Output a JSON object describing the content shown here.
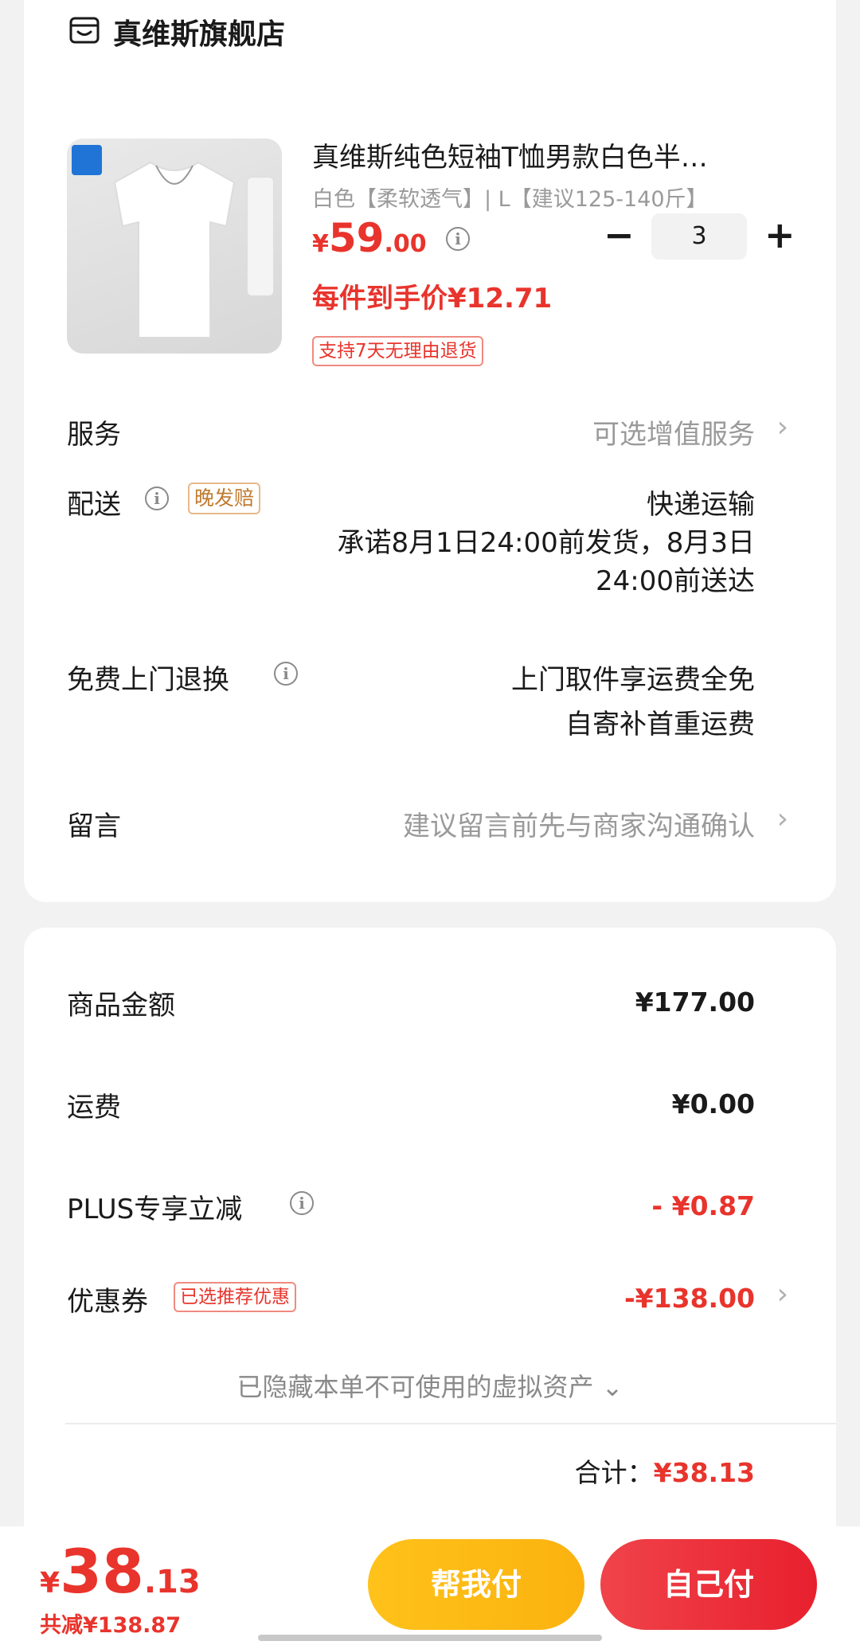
{
  "store": {
    "name": "真维斯旗舰店",
    "icon": "store-icon"
  },
  "product": {
    "title": "真维斯纯色短袖T恤男款白色半…",
    "variant": "白色【柔软透气】| L【建议125-140斤】",
    "price_symbol": "¥",
    "price_int": "59",
    "price_dec": ".00",
    "quantity": "3",
    "minus_label": "−",
    "plus_label": "+",
    "unit_price_label": "每件到手价¥12.71",
    "return_badge": "支持7天无理由退货"
  },
  "rows": {
    "service_label": "服务",
    "service_value": "可选增值服务",
    "delivery_label": "配送",
    "delivery_badge": "晚发赔",
    "delivery_method": "快递运输",
    "delivery_promise_line1": "承诺8月1日24:00前发货，8月3日",
    "delivery_promise_line2": "24:00前送达",
    "return_label": "免费上门退换",
    "return_line1": "上门取件享运费全免",
    "return_line2": "自寄补首重运费",
    "message_label": "留言",
    "message_placeholder": "建议留言前先与商家沟通确认"
  },
  "summary": {
    "goods_label": "商品金额",
    "goods_value": "¥177.00",
    "shipping_label": "运费",
    "shipping_value": "¥0.00",
    "plus_label": "PLUS专享立减",
    "plus_value": "- ¥0.87",
    "coupon_label": "优惠券",
    "coupon_badge": "已选推荐优惠",
    "coupon_value": "-¥138.00",
    "hidden_assets": "已隐藏本单不可使用的虚拟资产 ⌄",
    "total_label": "合计：",
    "total_value": "¥38.13"
  },
  "bottom_bar": {
    "price_symbol": "¥",
    "price_int": "38",
    "price_dec": ".13",
    "saved": "共减¥138.87",
    "help_pay": "帮我付",
    "self_pay": "自己付"
  },
  "colors": {
    "accent_red": "#e8342c",
    "help_pay_yellow": "#fbb20f",
    "self_pay_red": "#e8202e",
    "background": "#f2f2f2"
  }
}
